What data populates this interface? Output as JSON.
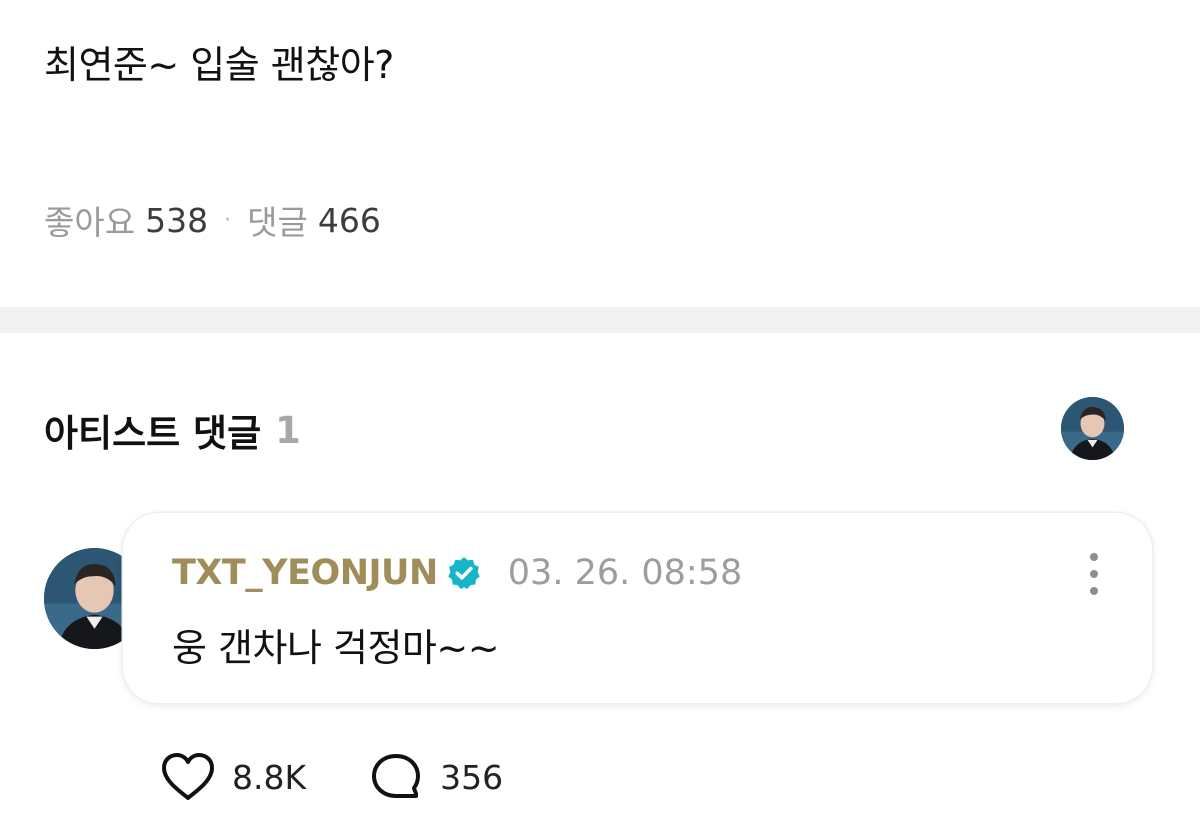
{
  "post": {
    "text": "최연준~ 입술 괜찮아?",
    "likes_label": "좋아요",
    "likes_count": "538",
    "separator": "·",
    "comments_label": "댓글",
    "comments_count": "466"
  },
  "artist_comments": {
    "title": "아티스트 댓글",
    "count": "1"
  },
  "comment": {
    "author": "TXT_YEONJUN",
    "verified_icon": "verified-badge-icon",
    "verified_color": "#16b6c8",
    "timestamp": "03. 26. 08:58",
    "text": "웅 갠차나 걱정마~~",
    "like_count": "8.8K",
    "reply_count": "356"
  },
  "colors": {
    "author": "#a08e5a",
    "muted": "#9d9d9d",
    "divider": "#f2f2f2"
  }
}
